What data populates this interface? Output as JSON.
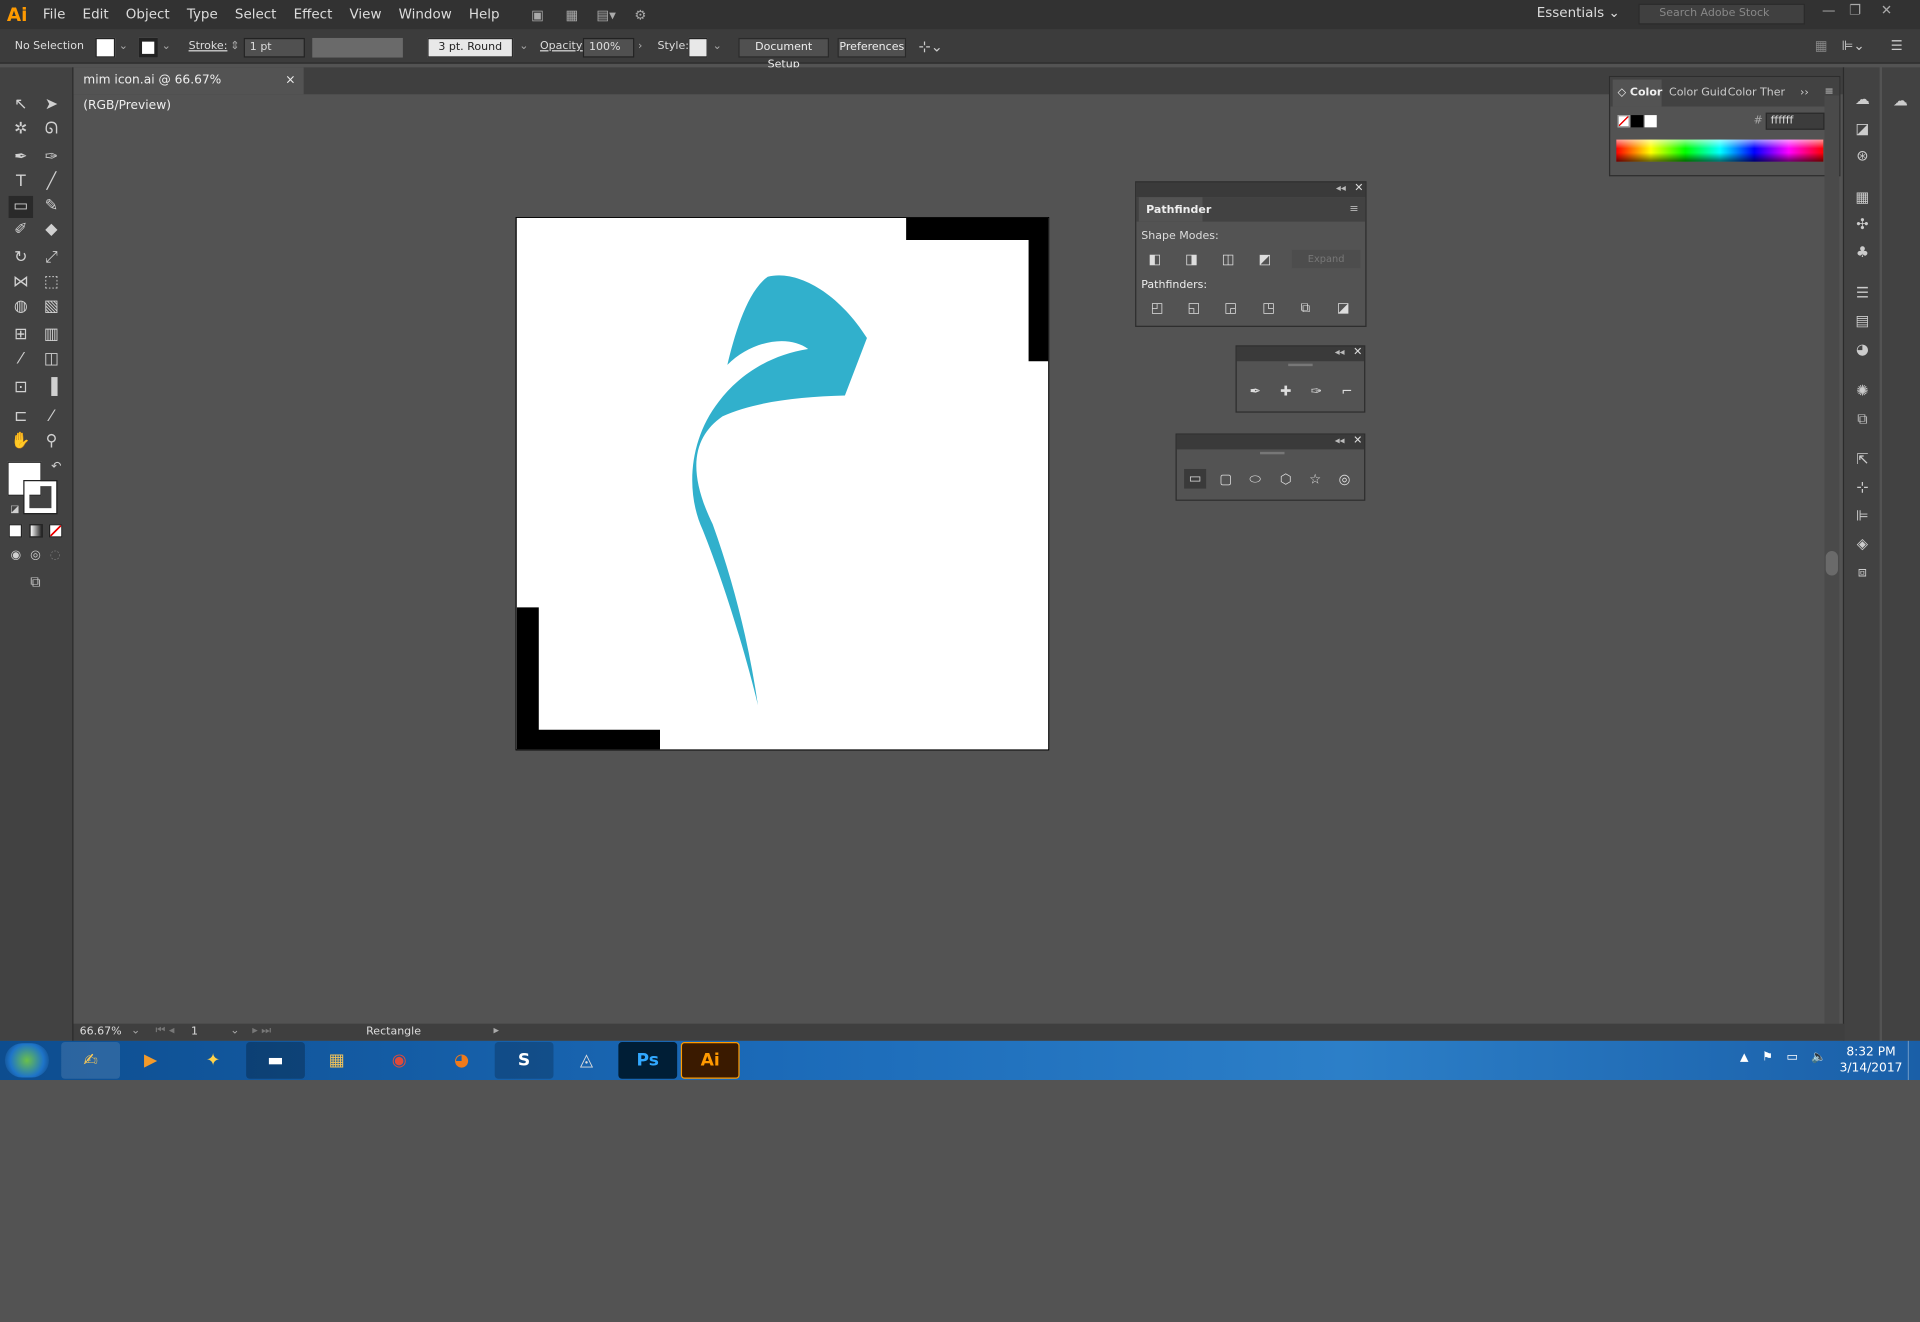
{
  "app": {
    "logo": "Ai"
  },
  "menu": [
    "File",
    "Edit",
    "Object",
    "Type",
    "Select",
    "Effect",
    "View",
    "Window",
    "Help"
  ],
  "workspace": {
    "label": "Essentials",
    "search_placeholder": "Search Adobe Stock"
  },
  "control": {
    "selection": "No Selection",
    "stroke_label": "Stroke:",
    "stroke_value": "1 pt",
    "brush": "3 pt. Round",
    "opacity_label": "Opacity:",
    "opacity_value": "100%",
    "style_label": "Style:",
    "document_setup": "Document Setup",
    "preferences": "Preferences"
  },
  "document": {
    "tab_title": "mim icon.ai @ 66.67% (RGB/Preview)",
    "close": "×"
  },
  "color_panel": {
    "tabs": [
      "Color",
      "Color Guid",
      "Color Ther"
    ],
    "hex_label": "#",
    "hex_value": "ffffff"
  },
  "pathfinder": {
    "title": "Pathfinder",
    "shape_modes": "Shape Modes:",
    "expand": "Expand",
    "pathfinders": "Pathfinders:"
  },
  "status": {
    "zoom": "66.67%",
    "page": "1",
    "tool": "Rectangle"
  },
  "taskbar": {
    "apps": [
      "Ps",
      "Ai"
    ],
    "time": "8:32 PM",
    "date": "3/14/2017"
  },
  "colors": {
    "glyph": "#31b0cc",
    "accent": "#ff9a00"
  }
}
